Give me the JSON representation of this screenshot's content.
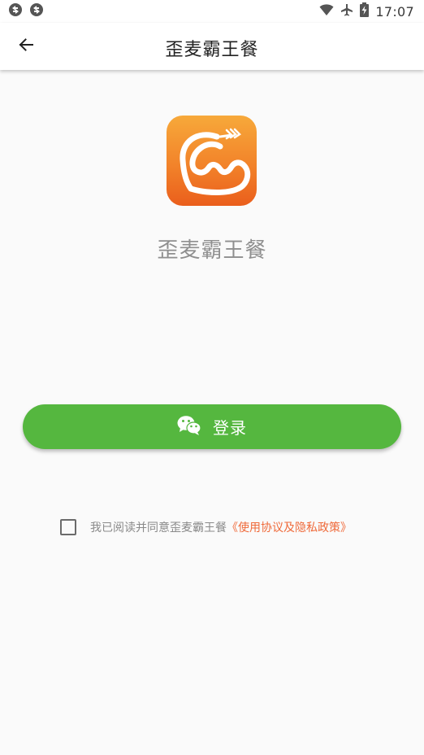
{
  "status_bar": {
    "time": "17:07",
    "icons": [
      "sync-icon",
      "sync-icon",
      "wifi-icon",
      "airplane-icon",
      "battery-charging-icon"
    ]
  },
  "header": {
    "title": "歪麦霸王餐",
    "back_icon": "arrow-left-icon"
  },
  "main": {
    "app_name": "歪麦霸王餐",
    "login_button_label": "登录",
    "login_icon": "wechat-icon",
    "agreement_text": "我已阅读并同意歪麦霸王餐",
    "policy_link": "《使用协议及隐私政策》",
    "agreement_checked": false
  },
  "colors": {
    "accent_green": "#55b73f",
    "link_orange": "#ef6a3a",
    "logo_top": "#f7a93a",
    "logo_bottom": "#ea5e1c"
  }
}
